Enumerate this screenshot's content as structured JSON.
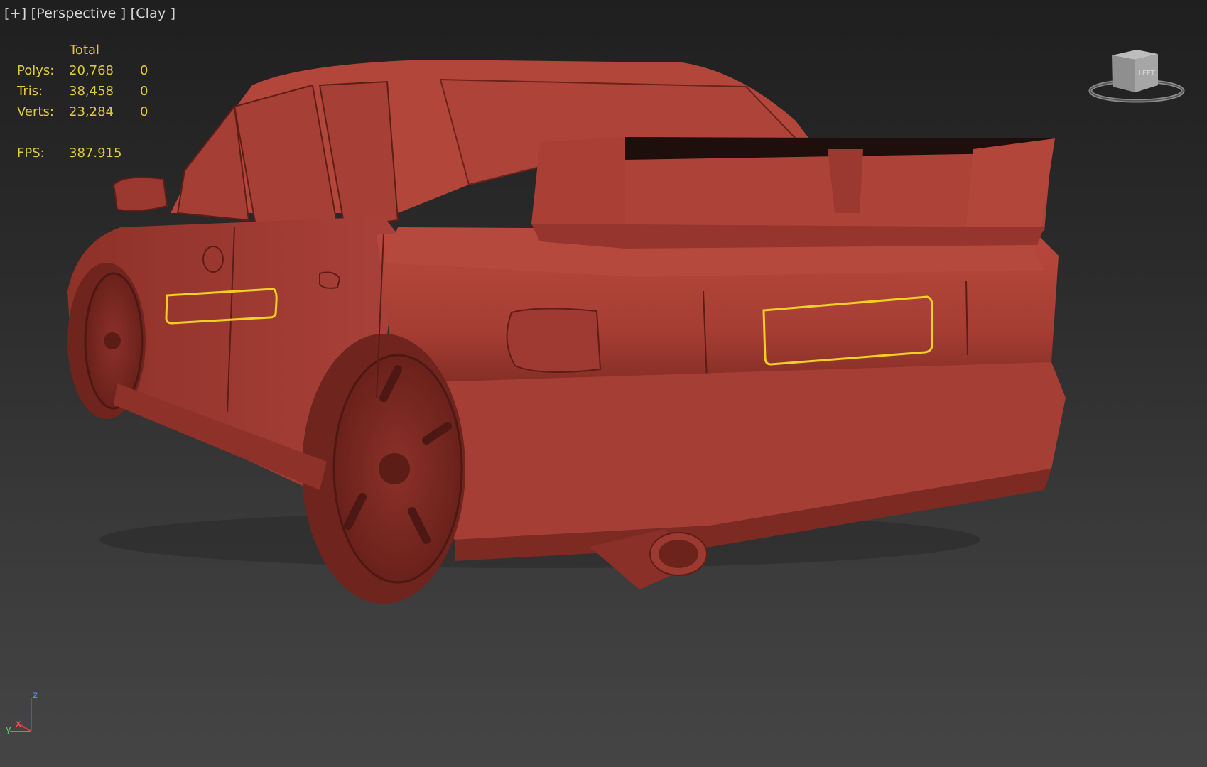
{
  "viewport": {
    "menu": "[+]",
    "view": "[Perspective ]",
    "shading": "[Clay ]"
  },
  "stats": {
    "header": "Total",
    "rows": [
      {
        "label": "Polys:",
        "total": "20,768",
        "selected": "0"
      },
      {
        "label": "Tris:",
        "total": "38,458",
        "selected": "0"
      },
      {
        "label": "Verts:",
        "total": "23,284",
        "selected": "0"
      }
    ],
    "fps_label": "FPS:",
    "fps_value": "387.915"
  },
  "viewcube": {
    "face_label": "LEFT",
    "icon": "viewcube-icon"
  },
  "axis": {
    "z": "z",
    "x": "x",
    "y": "y"
  },
  "colors": {
    "clay": "#b5453b",
    "clay_dark": "#7e2a22",
    "selection": "#f0d020",
    "stats_text": "#e2c93a"
  }
}
